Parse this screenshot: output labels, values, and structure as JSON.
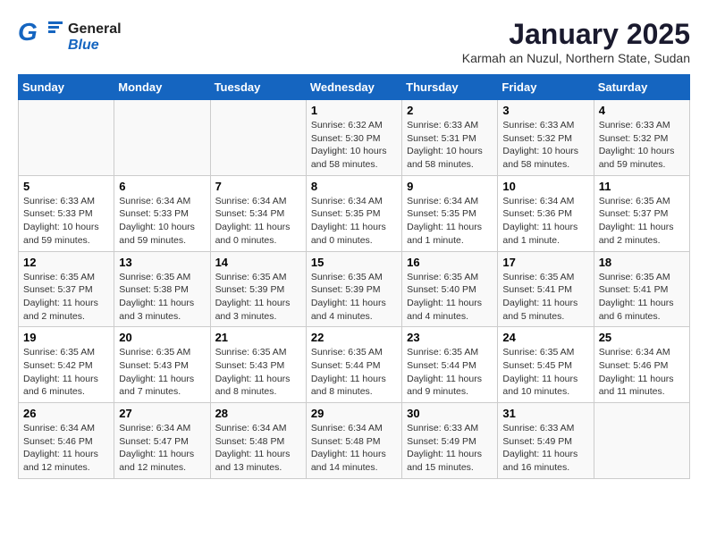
{
  "header": {
    "logo_general": "General",
    "logo_blue": "Blue",
    "month_title": "January 2025",
    "location": "Karmah an Nuzul, Northern State, Sudan"
  },
  "days_of_week": [
    "Sunday",
    "Monday",
    "Tuesday",
    "Wednesday",
    "Thursday",
    "Friday",
    "Saturday"
  ],
  "weeks": [
    [
      {
        "day": "",
        "info": ""
      },
      {
        "day": "",
        "info": ""
      },
      {
        "day": "",
        "info": ""
      },
      {
        "day": "1",
        "info": "Sunrise: 6:32 AM\nSunset: 5:30 PM\nDaylight: 10 hours\nand 58 minutes."
      },
      {
        "day": "2",
        "info": "Sunrise: 6:33 AM\nSunset: 5:31 PM\nDaylight: 10 hours\nand 58 minutes."
      },
      {
        "day": "3",
        "info": "Sunrise: 6:33 AM\nSunset: 5:32 PM\nDaylight: 10 hours\nand 58 minutes."
      },
      {
        "day": "4",
        "info": "Sunrise: 6:33 AM\nSunset: 5:32 PM\nDaylight: 10 hours\nand 59 minutes."
      }
    ],
    [
      {
        "day": "5",
        "info": "Sunrise: 6:33 AM\nSunset: 5:33 PM\nDaylight: 10 hours\nand 59 minutes."
      },
      {
        "day": "6",
        "info": "Sunrise: 6:34 AM\nSunset: 5:33 PM\nDaylight: 10 hours\nand 59 minutes."
      },
      {
        "day": "7",
        "info": "Sunrise: 6:34 AM\nSunset: 5:34 PM\nDaylight: 11 hours\nand 0 minutes."
      },
      {
        "day": "8",
        "info": "Sunrise: 6:34 AM\nSunset: 5:35 PM\nDaylight: 11 hours\nand 0 minutes."
      },
      {
        "day": "9",
        "info": "Sunrise: 6:34 AM\nSunset: 5:35 PM\nDaylight: 11 hours\nand 1 minute."
      },
      {
        "day": "10",
        "info": "Sunrise: 6:34 AM\nSunset: 5:36 PM\nDaylight: 11 hours\nand 1 minute."
      },
      {
        "day": "11",
        "info": "Sunrise: 6:35 AM\nSunset: 5:37 PM\nDaylight: 11 hours\nand 2 minutes."
      }
    ],
    [
      {
        "day": "12",
        "info": "Sunrise: 6:35 AM\nSunset: 5:37 PM\nDaylight: 11 hours\nand 2 minutes."
      },
      {
        "day": "13",
        "info": "Sunrise: 6:35 AM\nSunset: 5:38 PM\nDaylight: 11 hours\nand 3 minutes."
      },
      {
        "day": "14",
        "info": "Sunrise: 6:35 AM\nSunset: 5:39 PM\nDaylight: 11 hours\nand 3 minutes."
      },
      {
        "day": "15",
        "info": "Sunrise: 6:35 AM\nSunset: 5:39 PM\nDaylight: 11 hours\nand 4 minutes."
      },
      {
        "day": "16",
        "info": "Sunrise: 6:35 AM\nSunset: 5:40 PM\nDaylight: 11 hours\nand 4 minutes."
      },
      {
        "day": "17",
        "info": "Sunrise: 6:35 AM\nSunset: 5:41 PM\nDaylight: 11 hours\nand 5 minutes."
      },
      {
        "day": "18",
        "info": "Sunrise: 6:35 AM\nSunset: 5:41 PM\nDaylight: 11 hours\nand 6 minutes."
      }
    ],
    [
      {
        "day": "19",
        "info": "Sunrise: 6:35 AM\nSunset: 5:42 PM\nDaylight: 11 hours\nand 6 minutes."
      },
      {
        "day": "20",
        "info": "Sunrise: 6:35 AM\nSunset: 5:43 PM\nDaylight: 11 hours\nand 7 minutes."
      },
      {
        "day": "21",
        "info": "Sunrise: 6:35 AM\nSunset: 5:43 PM\nDaylight: 11 hours\nand 8 minutes."
      },
      {
        "day": "22",
        "info": "Sunrise: 6:35 AM\nSunset: 5:44 PM\nDaylight: 11 hours\nand 8 minutes."
      },
      {
        "day": "23",
        "info": "Sunrise: 6:35 AM\nSunset: 5:44 PM\nDaylight: 11 hours\nand 9 minutes."
      },
      {
        "day": "24",
        "info": "Sunrise: 6:35 AM\nSunset: 5:45 PM\nDaylight: 11 hours\nand 10 minutes."
      },
      {
        "day": "25",
        "info": "Sunrise: 6:34 AM\nSunset: 5:46 PM\nDaylight: 11 hours\nand 11 minutes."
      }
    ],
    [
      {
        "day": "26",
        "info": "Sunrise: 6:34 AM\nSunset: 5:46 PM\nDaylight: 11 hours\nand 12 minutes."
      },
      {
        "day": "27",
        "info": "Sunrise: 6:34 AM\nSunset: 5:47 PM\nDaylight: 11 hours\nand 12 minutes."
      },
      {
        "day": "28",
        "info": "Sunrise: 6:34 AM\nSunset: 5:48 PM\nDaylight: 11 hours\nand 13 minutes."
      },
      {
        "day": "29",
        "info": "Sunrise: 6:34 AM\nSunset: 5:48 PM\nDaylight: 11 hours\nand 14 minutes."
      },
      {
        "day": "30",
        "info": "Sunrise: 6:33 AM\nSunset: 5:49 PM\nDaylight: 11 hours\nand 15 minutes."
      },
      {
        "day": "31",
        "info": "Sunrise: 6:33 AM\nSunset: 5:49 PM\nDaylight: 11 hours\nand 16 minutes."
      },
      {
        "day": "",
        "info": ""
      }
    ]
  ]
}
